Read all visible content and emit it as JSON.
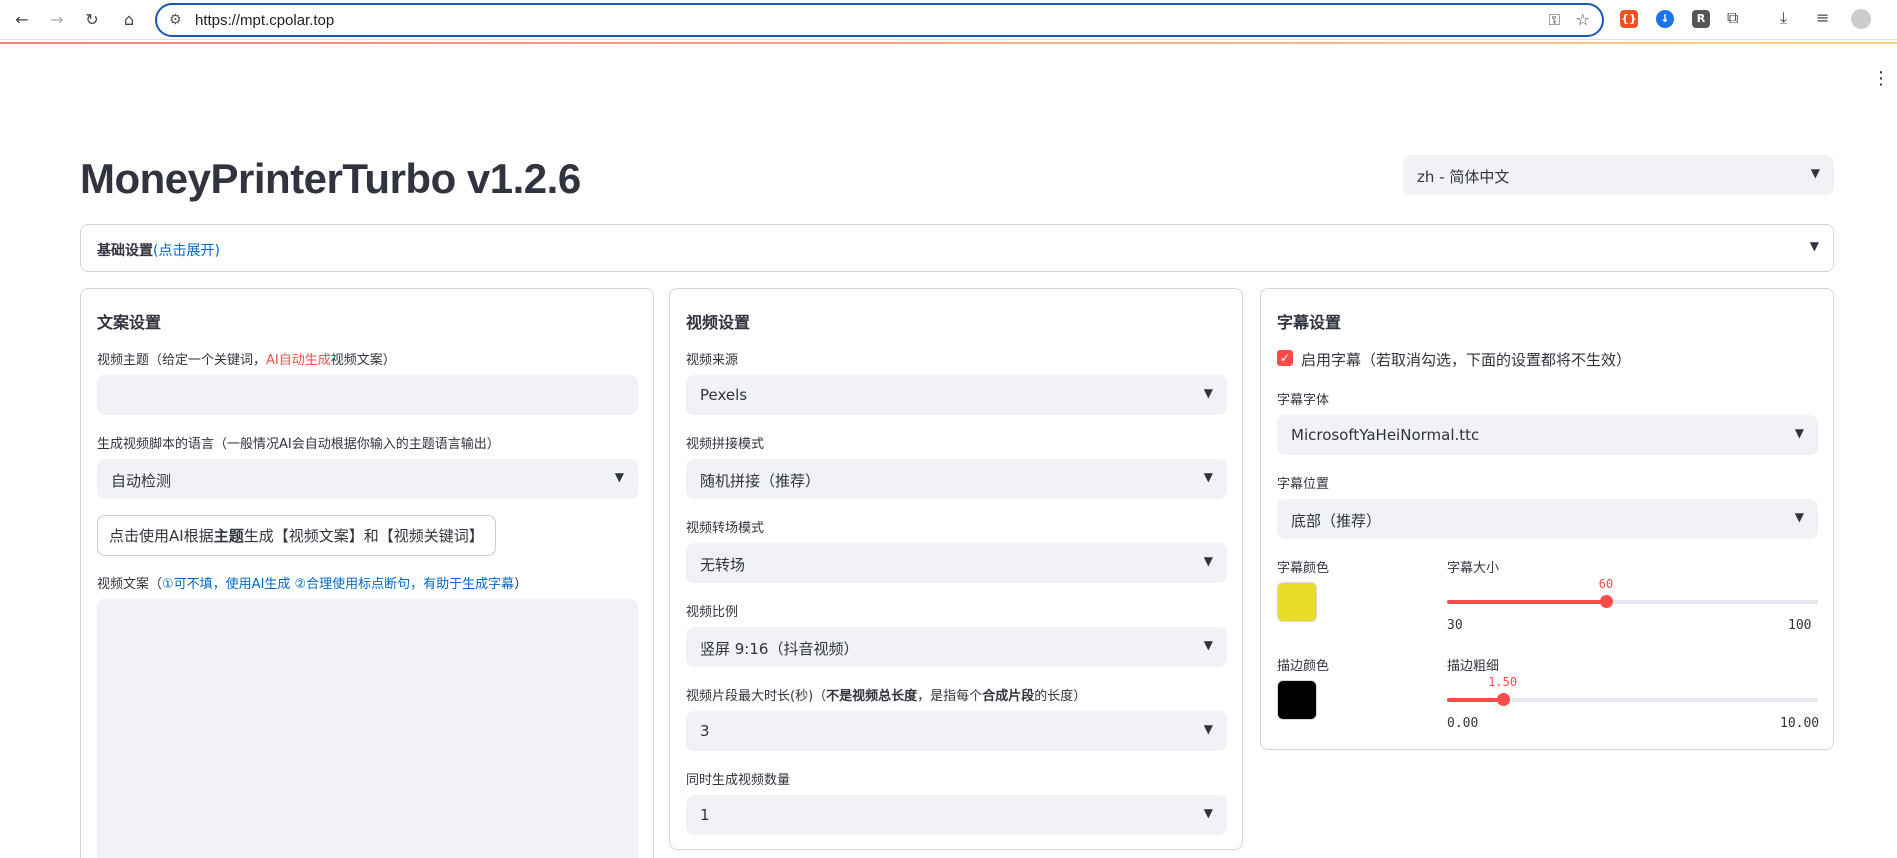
{
  "browser": {
    "url": "https://mpt.cpolar.top"
  },
  "app": {
    "title": "MoneyPrinterTurbo v1.2.6",
    "language_select": "zh - 简体中文",
    "basic_settings": {
      "label": "基础设置",
      "hint": "(点击展开)"
    }
  },
  "script_panel": {
    "title": "文案设置",
    "topic_label_a": "视频主题（给定一个关键词，",
    "topic_label_red": "AI自动生成",
    "topic_label_b": "视频文案）",
    "topic_value": "",
    "lang_label": "生成视频脚本的语言（一般情况AI会自动根据你输入的主题语言输出）",
    "lang_value": "自动检测",
    "gen_btn_a": "点击使用AI根据",
    "gen_btn_bold": "主题",
    "gen_btn_b": "生成【视频文案】和【视频关键词】",
    "script_label_a": "视频文案（",
    "script_label_blue": "①可不填，使用AI生成  ②合理使用标点断句，有助于生成字幕",
    "script_label_b": "）",
    "script_value": ""
  },
  "video_panel": {
    "title": "视频设置",
    "source_label": "视频来源",
    "source_value": "Pexels",
    "concat_label": "视频拼接模式",
    "concat_value": "随机拼接（推荐）",
    "transition_label": "视频转场模式",
    "transition_value": "无转场",
    "ratio_label": "视频比例",
    "ratio_value": "竖屏 9:16（抖音视频）",
    "clip_label_a": "视频片段最大时长(秒)（",
    "clip_label_b1": "不是视频总长度",
    "clip_label_c": "，是指每个",
    "clip_label_b2": "合成片段",
    "clip_label_d": "的长度）",
    "clip_value": "3",
    "count_label": "同时生成视频数量",
    "count_value": "1"
  },
  "subtitle_panel": {
    "title": "字幕设置",
    "enable_label": "启用字幕（若取消勾选，下面的设置都将不生效）",
    "enable_checked": true,
    "font_label": "字幕字体",
    "font_value": "MicrosoftYaHeiNormal.ttc",
    "position_label": "字幕位置",
    "position_value": "底部（推荐）",
    "color_label": "字幕颜色",
    "color_value": "#ebdc2a",
    "size_label": "字幕大小",
    "size": {
      "value": "60",
      "min": "30",
      "max": "100",
      "v": 60,
      "lo": 30,
      "hi": 100
    },
    "stroke_color_label": "描边颜色",
    "stroke_color_value": "#000000",
    "stroke_width_label": "描边粗细",
    "stroke": {
      "value": "1.50",
      "min": "0.00",
      "max": "10.00",
      "v": 1.5,
      "lo": 0,
      "hi": 10
    }
  }
}
